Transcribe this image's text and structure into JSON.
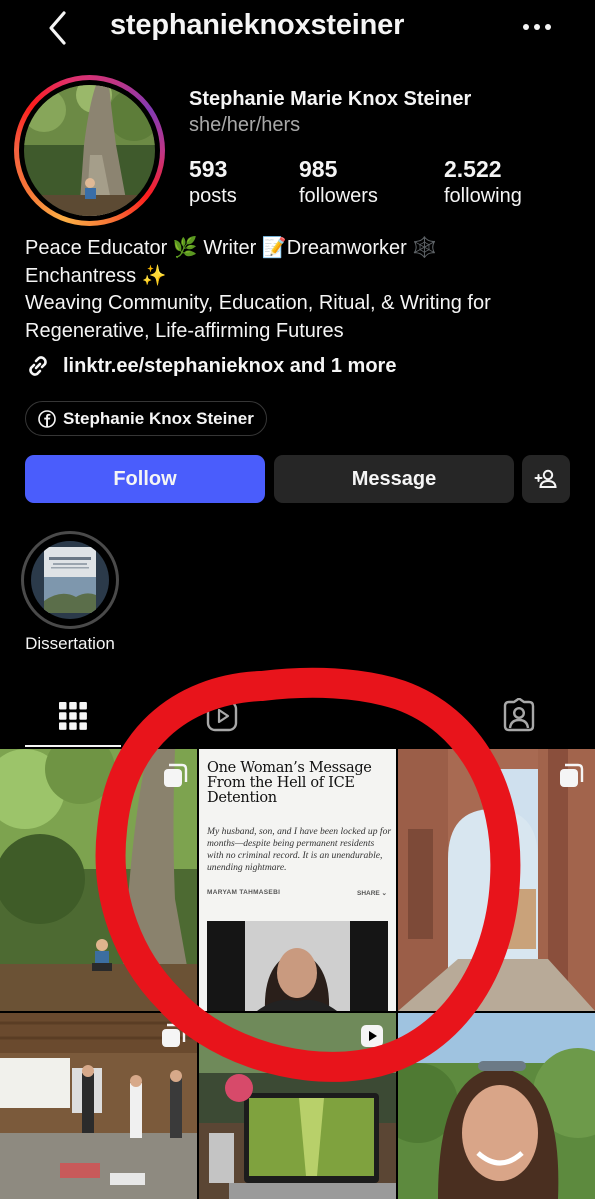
{
  "header": {
    "username": "stephanieknoxsteiner"
  },
  "profile": {
    "full_name": "Stephanie Marie Knox Steiner",
    "pronouns": "she/her/hers",
    "stats": {
      "posts_count": "593",
      "posts_label": "posts",
      "followers_count": "985",
      "followers_label": "followers",
      "following_count": "2.522",
      "following_label": "following"
    },
    "bio": {
      "line1": "Peace Educator 🌿 Writer 📝Dreamworker 🕸️",
      "line2": "Enchantress ✨",
      "line3": "Weaving Community, Education, Ritual, & Writing for",
      "line4": "Regenerative, Life-affirming Futures"
    },
    "link": "linktr.ee/stephanieknox and 1 more",
    "facebook_chip": "Stephanie Knox Steiner"
  },
  "actions": {
    "follow": "Follow",
    "message": "Message"
  },
  "highlights": [
    {
      "label": "Dissertation"
    }
  ],
  "grid": {
    "article": {
      "title": "One Woman’s Message From the Hell of ICE Detention",
      "subtitle": "My husband, son, and I have been locked up for months—despite being permanent residents with no criminal record. It is an unendurable, unending nightmare.",
      "author": "MARYAM TAHMASEBI",
      "share": "SHARE ⌄"
    }
  },
  "colors": {
    "follow_button": "#4a5dfc",
    "annotation_circle": "#e8141b"
  }
}
